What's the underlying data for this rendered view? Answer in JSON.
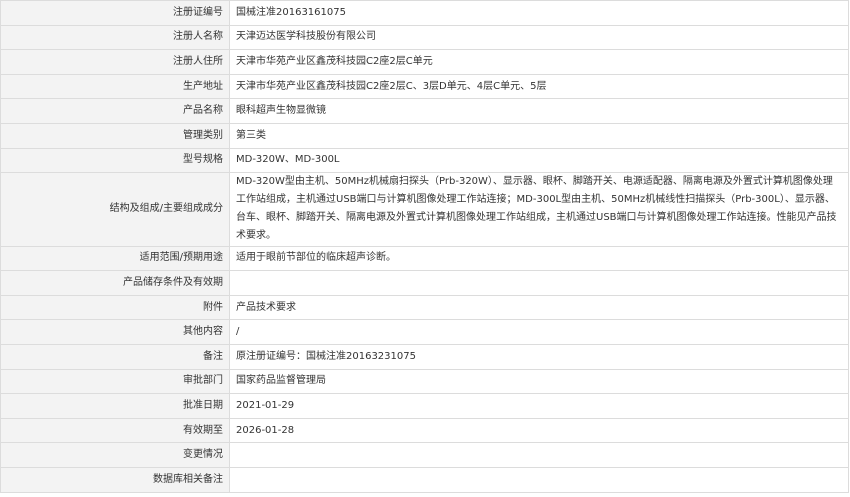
{
  "rows": [
    {
      "label": "注册证编号",
      "value": "国械注准20163161075"
    },
    {
      "label": "注册人名称",
      "value": "天津迈达医学科技股份有限公司"
    },
    {
      "label": "注册人住所",
      "value": "天津市华苑产业区鑫茂科技园C2座2层C单元"
    },
    {
      "label": "生产地址",
      "value": "天津市华苑产业区鑫茂科技园C2座2层C、3层D单元、4层C单元、5层"
    },
    {
      "label": "产品名称",
      "value": "眼科超声生物显微镜"
    },
    {
      "label": "管理类别",
      "value": "第三类"
    },
    {
      "label": "型号规格",
      "value": "MD-320W、MD-300L"
    },
    {
      "label": "结构及组成/主要组成成分",
      "value": "MD-320W型由主机、50MHz机械扇扫探头（Prb-320W）、显示器、眼杯、脚踏开关、电源适配器、隔离电源及外置式计算机图像处理工作站组成，主机通过USB端口与计算机图像处理工作站连接；MD-300L型由主机、50MHz机械线性扫描探头（Prb-300L）、显示器、台车、眼杯、脚踏开关、隔离电源及外置式计算机图像处理工作站组成，主机通过USB端口与计算机图像处理工作站连接。性能见产品技术要求。"
    },
    {
      "label": "适用范围/预期用途",
      "value": "适用于眼前节部位的临床超声诊断。"
    },
    {
      "label": "产品储存条件及有效期",
      "value": ""
    },
    {
      "label": "附件",
      "value": "产品技术要求"
    },
    {
      "label": "其他内容",
      "value": "/"
    },
    {
      "label": "备注",
      "value": "原注册证编号：国械注准20163231075"
    },
    {
      "label": "审批部门",
      "value": "国家药品监督管理局"
    },
    {
      "label": "批准日期",
      "value": "2021-01-29"
    },
    {
      "label": "有效期至",
      "value": "2026-01-28"
    },
    {
      "label": "变更情况",
      "value": ""
    },
    {
      "label": "数据库相关备注",
      "value": ""
    }
  ]
}
